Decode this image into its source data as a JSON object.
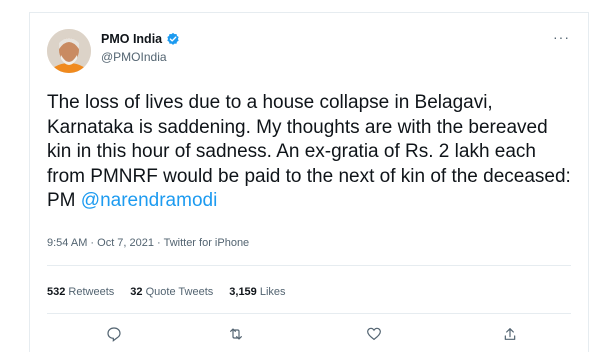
{
  "tweet": {
    "display_name": "PMO India",
    "handle": "@PMOIndia",
    "more_label": "···",
    "text_before_mention": "The loss of lives due to a house collapse in Belagavi, Karnataka is saddening. My thoughts are with the bereaved kin in this hour of sadness. An ex-gratia of Rs. 2 lakh each from PMNRF would be paid to the next of kin of the deceased: PM ",
    "mention": "@narendramodi",
    "meta": "9:54 AM · Oct 7, 2021 · Twitter for iPhone"
  },
  "stats": {
    "retweets_count": "532",
    "retweets_label": "Retweets",
    "quotes_count": "32",
    "quotes_label": "Quote Tweets",
    "likes_count": "3,159",
    "likes_label": "Likes"
  },
  "colors": {
    "verified": "#1d9bf0",
    "link": "#1d9bf0",
    "secondary_text": "#536471",
    "divider": "#e6ecf0"
  },
  "icons": [
    "verified-badge-icon",
    "more-icon",
    "reply-icon",
    "retweet-icon",
    "like-icon",
    "share-icon"
  ]
}
